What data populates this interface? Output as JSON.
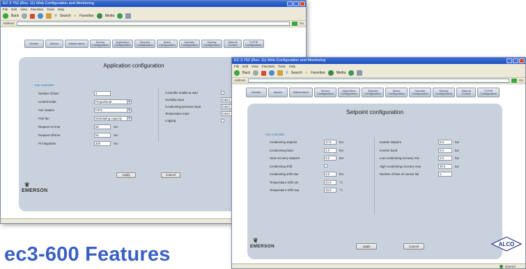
{
  "window_title": "EC 3 752 (Rev. 11) Web Configuration and Monitoring",
  "menu": [
    "File",
    "Edit",
    "View",
    "Favorites",
    "Tools",
    "Help"
  ],
  "toolbar": {
    "back": "Back",
    "search": "Search",
    "favorites": "Favorites",
    "media": "Media"
  },
  "address_label": "Address",
  "go_label": "Go",
  "nav_tabs": [
    "Monitor",
    "Alarms",
    "Maintenance",
    "Sensor Configuration",
    "Application Configuration",
    "Setpoint Configuration",
    "Alarm Configuration",
    "Actuator Configuration",
    "Display Configuration",
    "Manual Control",
    "TCP/IP Configuration"
  ],
  "back_window": {
    "panel_title": "Application configuration",
    "section": "Fan controller",
    "left_fields": [
      {
        "label": "Number of fans",
        "value": "4",
        "kind": "input",
        "unit": ""
      },
      {
        "label": "Control mode",
        "value": "Proportional",
        "kind": "select",
        "unit": ""
      },
      {
        "label": "Fan rotation",
        "value": "FIFO",
        "kind": "select",
        "unit": ""
      },
      {
        "label": "First fan",
        "value": "Modulating capacity",
        "kind": "select",
        "unit": ""
      },
      {
        "label": "Request on time",
        "value": "50",
        "kind": "input",
        "unit": "sec"
      },
      {
        "label": "Request off time",
        "value": "52",
        "kind": "input",
        "unit": "sec"
      },
      {
        "label": "PI integration",
        "value": "300",
        "kind": "input",
        "unit": "sec"
      }
    ],
    "right_fields": [
      {
        "label": "Controller enable at start",
        "value": "",
        "kind": "check"
      },
      {
        "label": "Humidity input",
        "value": "Intern",
        "kind": "input"
      },
      {
        "label": "Condensing pressure input",
        "value": "Intern",
        "kind": "input"
      },
      {
        "label": "Temperature input",
        "value": "Intern",
        "kind": "input"
      },
      {
        "label": "Logging",
        "value": "",
        "kind": "check"
      }
    ],
    "apply": "Apply",
    "cancel": "Cancel"
  },
  "front_window": {
    "panel_title": "Setpoint configuration",
    "section": "Fan controller",
    "left_fields": [
      {
        "label": "Condensing setpoint",
        "value": "17.0",
        "kind": "input",
        "unit": "bar"
      },
      {
        "label": "Condensing band",
        "value": "2.0",
        "kind": "input",
        "unit": "bar"
      },
      {
        "label": "Heat recovery setpoint",
        "value": "3.0",
        "kind": "input",
        "unit": "bar"
      },
      {
        "label": "Condensing shift",
        "value": "",
        "kind": "check",
        "unit": ""
      },
      {
        "label": "Condensing shift max",
        "value": "3.0",
        "kind": "input",
        "unit": "bar"
      },
      {
        "label": "Temperature shift min",
        "value": "24.0",
        "kind": "input",
        "unit": "°C"
      },
      {
        "label": "Temperature shift max",
        "value": "13.0",
        "kind": "input",
        "unit": "°C"
      }
    ],
    "right_fields": [
      {
        "label": "Inverter setpoint",
        "value": "6.0",
        "kind": "input",
        "unit": "bar"
      },
      {
        "label": "Inverter band",
        "value": "5.0",
        "kind": "input",
        "unit": "bar"
      },
      {
        "label": "Low condensing recovery min",
        "value": "2.0",
        "kind": "input",
        "unit": "bar"
      },
      {
        "label": "High condensing recovery max",
        "value": "30.0",
        "kind": "input",
        "unit": "bar"
      },
      {
        "label": "Number of fans on sensor fail",
        "value": "1",
        "kind": "input",
        "unit": ""
      }
    ],
    "apply": "Apply",
    "cancel": "Cancel",
    "alco_logo": "ALCO"
  },
  "emerson_logo": "EMERSON",
  "status_text": "Internet",
  "headline": "ec3-600 Features"
}
